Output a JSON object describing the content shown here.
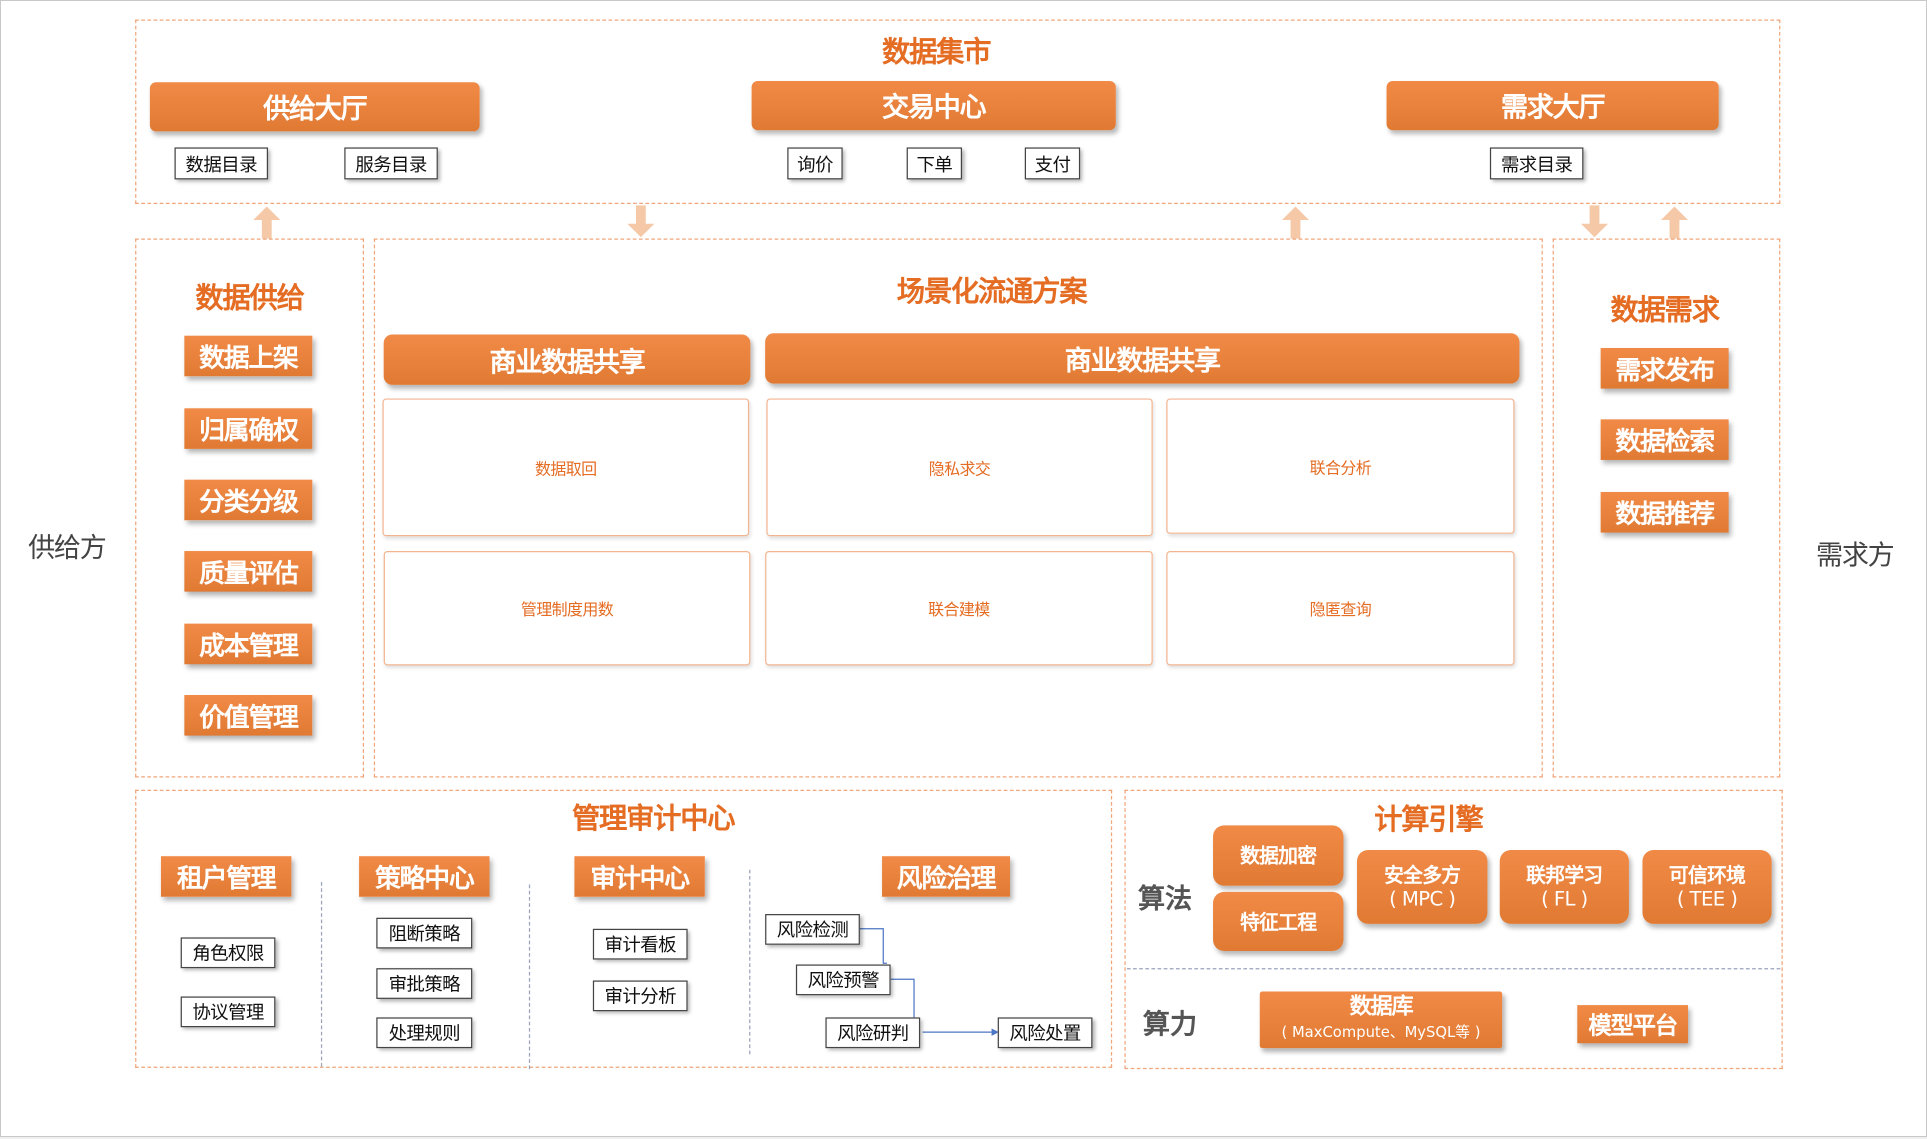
{
  "side_labels": {
    "left": "供给方",
    "right": "需求方"
  },
  "market": {
    "title": "数据集市",
    "supply_hall": {
      "label": "供给大厅",
      "items": [
        "数据目录",
        "服务目录"
      ]
    },
    "trade_center": {
      "label": "交易中心",
      "items": [
        "询价",
        "下单",
        "支付"
      ]
    },
    "demand_hall": {
      "label": "需求大厅",
      "items": [
        "需求目录"
      ]
    }
  },
  "supply": {
    "title": "数据供给",
    "items": [
      "数据上架",
      "归属确权",
      "分类分级",
      "质量评估",
      "成本管理",
      "价值管理"
    ]
  },
  "scenario": {
    "title": "场景化流通方案",
    "left_header": "商业数据共享",
    "right_header": "商业数据共享",
    "cells": [
      "数据取回",
      "隐私求交",
      "联合分析",
      "管理制度用数",
      "联合建模",
      "隐匿查询"
    ]
  },
  "demand": {
    "title": "数据需求",
    "items": [
      "需求发布",
      "数据检索",
      "数据推荐"
    ]
  },
  "audit": {
    "title": "管理审计中心",
    "tenant": {
      "label": "租户管理",
      "items": [
        "角色权限",
        "协议管理"
      ]
    },
    "policy": {
      "label": "策略中心",
      "items": [
        "阻断策略",
        "审批策略",
        "处理规则"
      ]
    },
    "audit_center": {
      "label": "审计中心",
      "items": [
        "审计看板",
        "审计分析"
      ]
    },
    "risk": {
      "label": "风险治理",
      "items": [
        "风险检测",
        "风险预警",
        "风险研判",
        "风险处置"
      ]
    }
  },
  "engine": {
    "title": "计算引擎",
    "algo_label": "算法",
    "algo": {
      "encrypt": "数据加密",
      "feature": "特征工程",
      "mpc": {
        "name": "安全多方",
        "sub": "( MPC )"
      },
      "fl": {
        "name": "联邦学习",
        "sub": "( FL )"
      },
      "tee": {
        "name": "可信环境",
        "sub": "( TEE )"
      }
    },
    "power_label": "算力",
    "power": {
      "db": {
        "name": "数据库",
        "sub": "( MaxCompute、MySQL等 )"
      },
      "model": "模型平台"
    }
  },
  "colors": {
    "orange": "#e07a33",
    "text_orange": "#e46c23",
    "dash": "#f0a57a",
    "arrow": "#f5c9a8"
  }
}
